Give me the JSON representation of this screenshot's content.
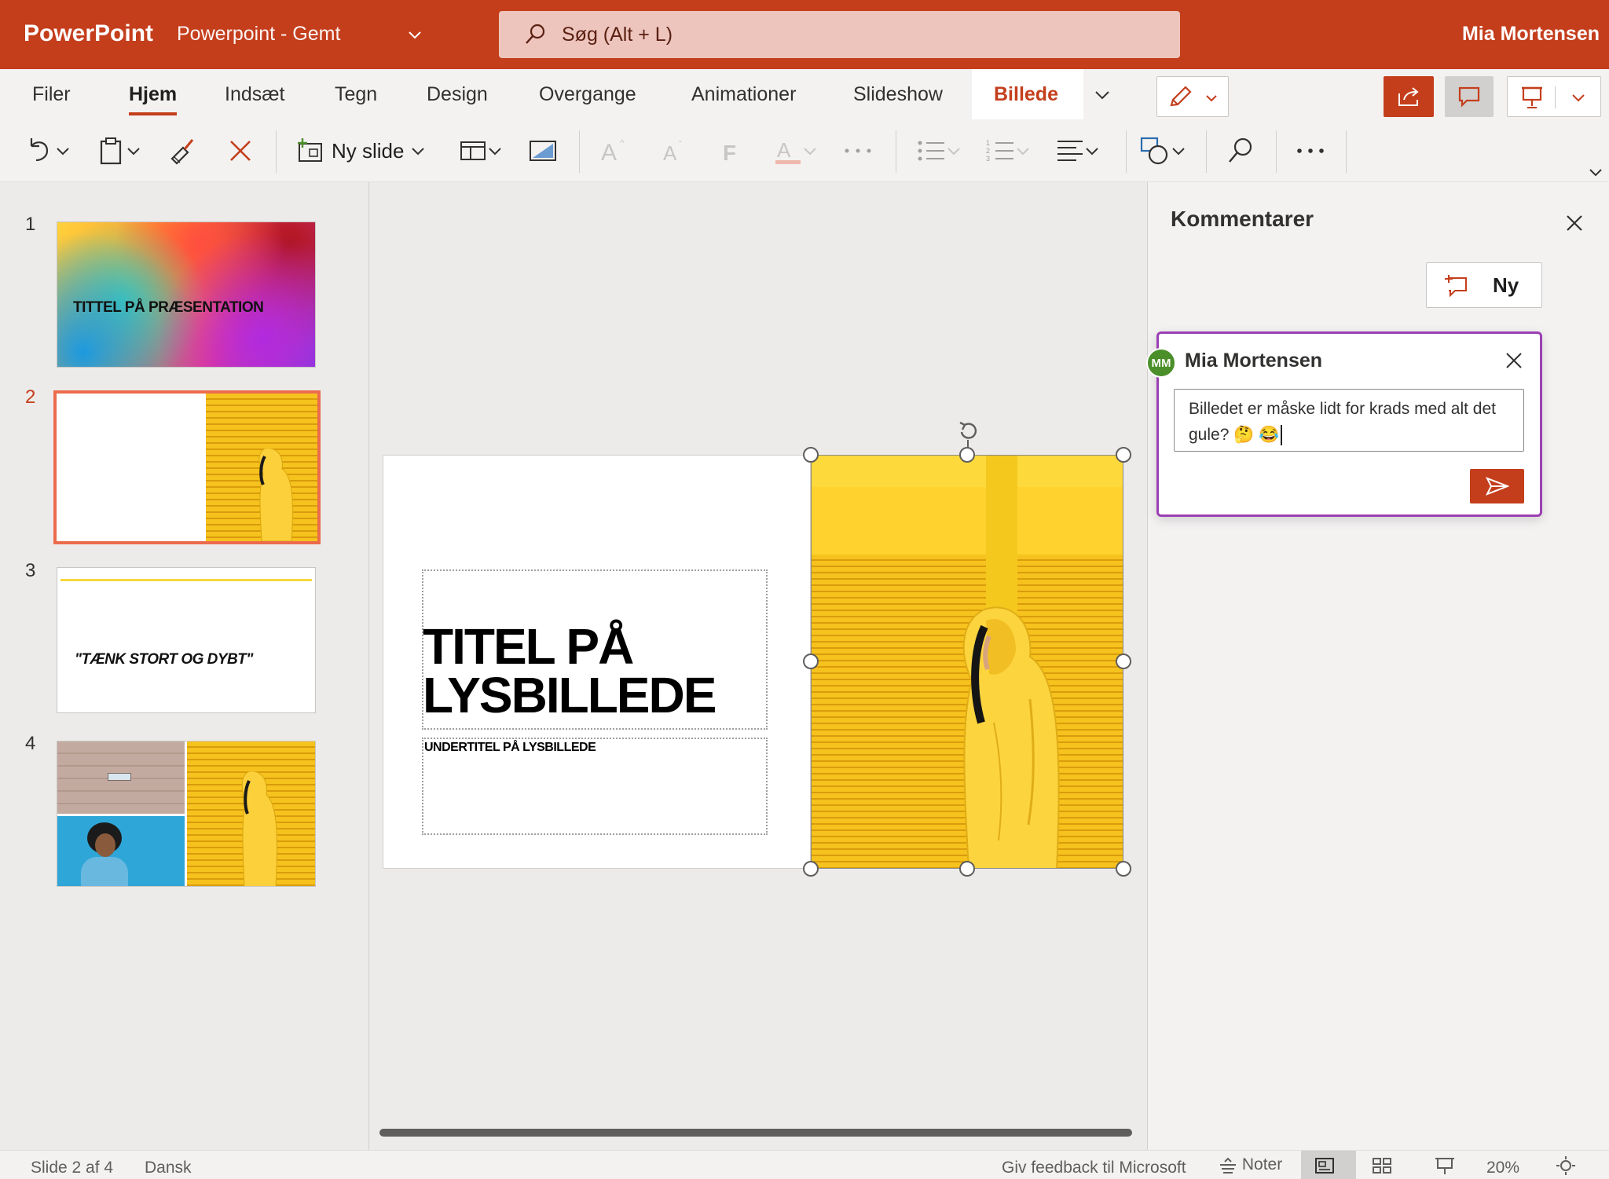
{
  "titlebar": {
    "app_name": "PowerPoint",
    "doc_title": "Powerpoint  -  Gemt",
    "search_placeholder": "Søg (Alt + L)",
    "user": "Mia Mortensen"
  },
  "tabs": [
    {
      "label": "Filer"
    },
    {
      "label": "Hjem",
      "active": true
    },
    {
      "label": "Indsæt"
    },
    {
      "label": "Tegn"
    },
    {
      "label": "Design"
    },
    {
      "label": "Overgange"
    },
    {
      "label": "Animationer"
    },
    {
      "label": "Slideshow"
    },
    {
      "label": "Billede",
      "contextual": true
    }
  ],
  "toolbar": {
    "new_slide_label": "Ny slide"
  },
  "slides": [
    {
      "number": "1",
      "title": "TITTEL PÅ PRÆSENTATION"
    },
    {
      "number": "2",
      "active": true
    },
    {
      "number": "3",
      "quote": "\"TÆNK STORT OG DYBT\""
    },
    {
      "number": "4"
    }
  ],
  "canvas": {
    "slide_title": "TITEL PÅ LYSBILLEDE",
    "slide_subtitle": "UNDERTITEL PÅ LYSBILLEDE"
  },
  "comments": {
    "pane_title": "Kommentarer",
    "new_label": "Ny",
    "card": {
      "avatar": "MM",
      "author": "Mia Mortensen",
      "text": "Billedet er måske lidt for krads med alt det gule? 🤔 😂"
    }
  },
  "statusbar": {
    "slide_info": "Slide 2 af 4",
    "language": "Dansk",
    "feedback": "Giv feedback til Microsoft",
    "notes": "Noter",
    "zoom": "20%"
  },
  "colors": {
    "accent": "#c43e1c",
    "comment_border": "#9b3fb3",
    "avatar": "#4a8f29",
    "selected_slide_border": "#ec6b4d",
    "photo_yellow": "#f6c21d"
  }
}
